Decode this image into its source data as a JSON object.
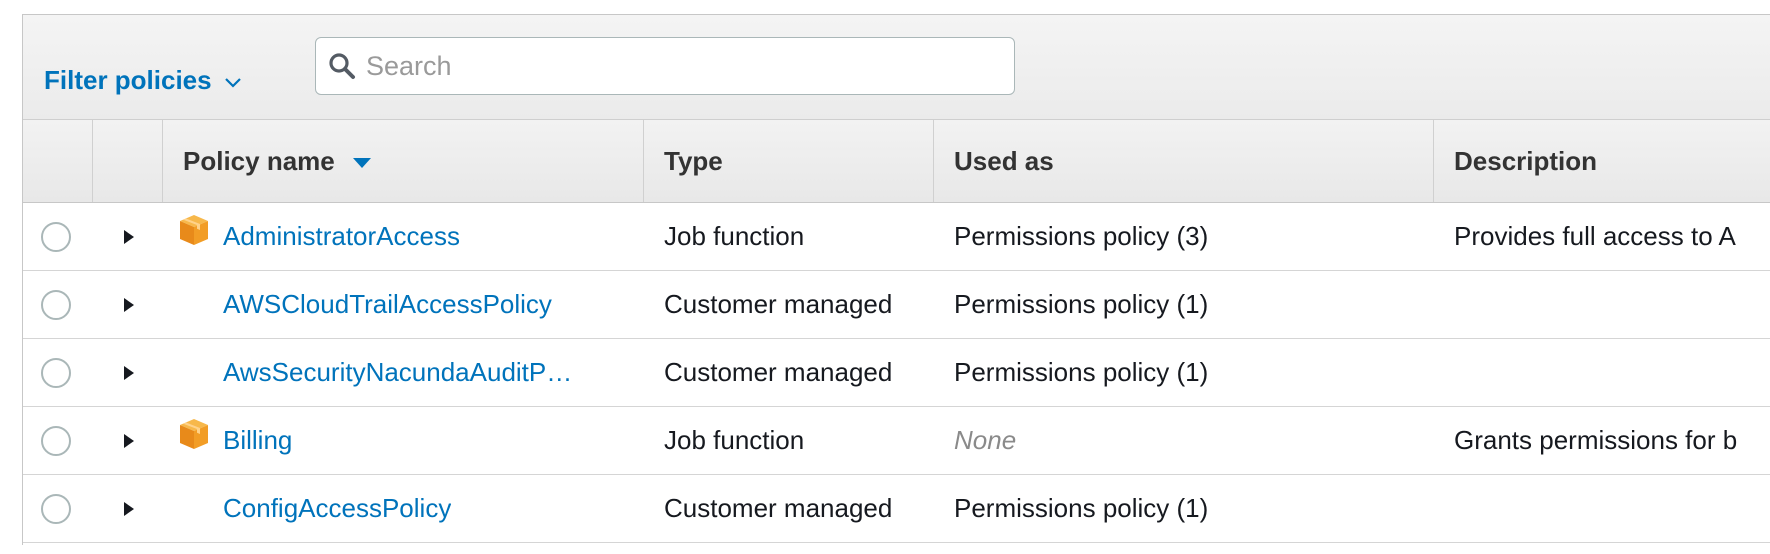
{
  "toolbar": {
    "filter_label": "Filter policies",
    "search_placeholder": "Search"
  },
  "table": {
    "headers": {
      "policy_name": "Policy name",
      "type": "Type",
      "used_as": "Used as",
      "description": "Description"
    },
    "sort": {
      "column": "Policy name",
      "direction": "descending-caret"
    },
    "rows": [
      {
        "name": "AdministratorAccess",
        "aws_managed_icon": true,
        "type": "Job function",
        "used_as": "Permissions policy (3)",
        "description": "Provides full access to A"
      },
      {
        "name": "AWSCloudTrailAccessPolicy",
        "aws_managed_icon": false,
        "type": "Customer managed",
        "used_as": "Permissions policy (1)",
        "description": ""
      },
      {
        "name": "AwsSecurityNacundaAuditP…",
        "aws_managed_icon": false,
        "type": "Customer managed",
        "used_as": "Permissions policy (1)",
        "description": ""
      },
      {
        "name": "Billing",
        "aws_managed_icon": true,
        "type": "Job function",
        "used_as": "None",
        "used_as_none": true,
        "description": "Grants permissions for b"
      },
      {
        "name": "ConfigAccessPolicy",
        "aws_managed_icon": false,
        "type": "Customer managed",
        "used_as": "Permissions policy (1)",
        "description": ""
      }
    ]
  },
  "colors": {
    "link": "#0073bb",
    "aws_icon": "#f29d26",
    "muted": "#8a8a8a"
  },
  "icons": [
    "search-icon",
    "chevron-down-icon",
    "sort-caret-icon",
    "expand-caret-icon",
    "aws-managed-box-icon"
  ]
}
